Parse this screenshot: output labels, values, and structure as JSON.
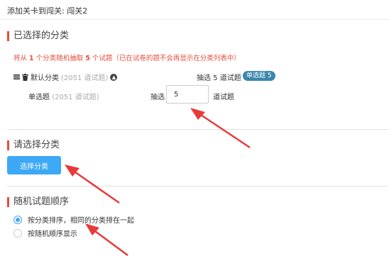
{
  "header": {
    "title": "添加关卡到闯关: 闯关2"
  },
  "selected_section": {
    "title": "已选择的分类",
    "notice": {
      "prefix": "将从",
      "cat_count": "1",
      "middle": "个分类随机抽取",
      "q_count": "5",
      "suffix": "个试题（已在试卷的题不会再显示在分类列表中）"
    },
    "category": {
      "name": "默认分类",
      "count_note": "(2051 道试题)",
      "pick_label": "抽选 5 道试题",
      "badge": "单选题 5"
    },
    "subtype": {
      "name": "单选题",
      "count_note": "(2051 道试题)",
      "pick_prefix": "抽选",
      "pick_value": "5",
      "pick_suffix": "道试题"
    }
  },
  "choose_section": {
    "title": "请选择分类",
    "button_label": "选择分类"
  },
  "order_section": {
    "title": "随机试题顺序",
    "options": [
      {
        "label": "按分类排序，相同的分类排在一起",
        "selected": true
      },
      {
        "label": "按随机顺序显示",
        "selected": false
      }
    ]
  },
  "colors": {
    "accent_blue": "#3da8f5",
    "badge_blue": "#3a87ad",
    "notice_red": "#e74c3c",
    "annotation_arrow": "#e83a3a"
  },
  "icons": [
    "list-icon",
    "trash-icon",
    "chevron-up-circle-icon"
  ]
}
